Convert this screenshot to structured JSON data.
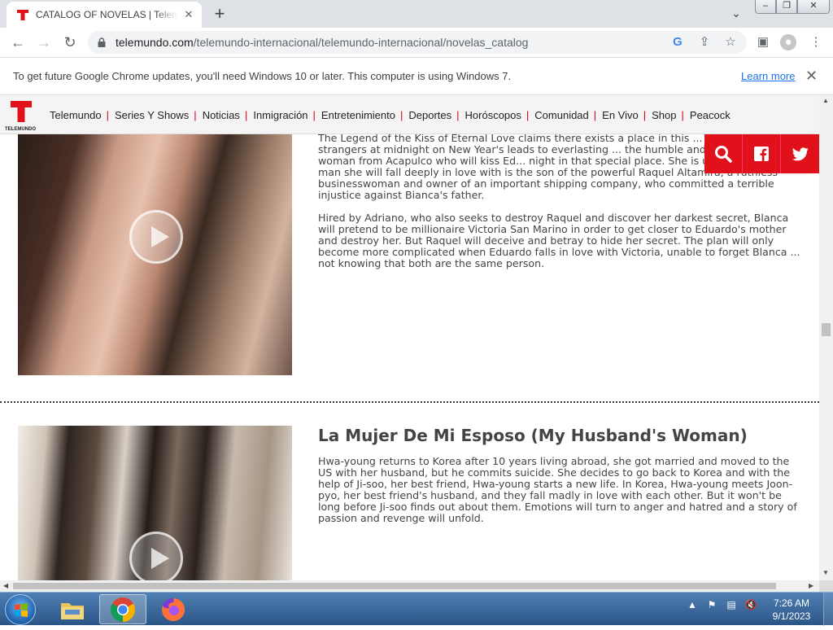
{
  "browser": {
    "tab_title": "CATALOG OF NOVELAS | Telemundo",
    "url_host": "telemundo.com",
    "url_path": "/telemundo-internacional/telemundo-internacional/novelas_catalog",
    "infobar_message": "To get future Google Chrome updates, you'll need Windows 10 or later. This computer is using Windows 7.",
    "infobar_link": "Learn more"
  },
  "site": {
    "logo_text": "TELEMUNDO",
    "nav": [
      "Telemundo",
      "Series Y Shows",
      "Noticias",
      "Inmigración",
      "Entretenimiento",
      "Deportes",
      "Horóscopos",
      "Comunidad",
      "En Vivo",
      "Shop",
      "Peacock"
    ],
    "brand_color": "#e1111c"
  },
  "novelas": [
    {
      "title": "",
      "paragraphs": [
        "The Legend of the Kiss of Eternal Love claims there exists a place in this ... kiss between two strangers at midnight on New Year's leads to everlasting ... the humble and beautiful young woman from Acapulco who will kiss Ed... night in that special place. She is unaware that the man she will fall deeply in love with is the son of the powerful Raquel Altamira, a ruthless businesswoman and owner of an important shipping company, who committed a terrible injustice against Bianca's father.",
        "Hired by Adriano, who also seeks to destroy Raquel and discover her darkest secret, Blanca will pretend to be millionaire Victoria San Marino in order to get closer to Eduardo's mother and destroy her. But Raquel will deceive and betray to hide her secret. The plan will only become more complicated when Eduardo falls in love with Victoria, unable to forget Blanca ... not knowing that both are the same person."
      ]
    },
    {
      "title": "La Mujer De Mi Esposo (My Husband's Woman)",
      "paragraphs": [
        "Hwa-young returns to Korea after 10 years living abroad, she got married and moved to the US with her husband, but he commits suicide. She decides to go back to Korea and with the help of Ji-soo, her best friend, Hwa-young starts a new life. In Korea, Hwa-young meets Joon-pyo, her best friend's husband, and they fall madly in love with each other.  But it won't be long before Ji-soo finds out about them. Emotions will turn to anger and hatred and a story of passion and revenge will unfold."
      ]
    }
  ],
  "taskbar": {
    "time": "7:26 AM",
    "date": "9/1/2023"
  }
}
